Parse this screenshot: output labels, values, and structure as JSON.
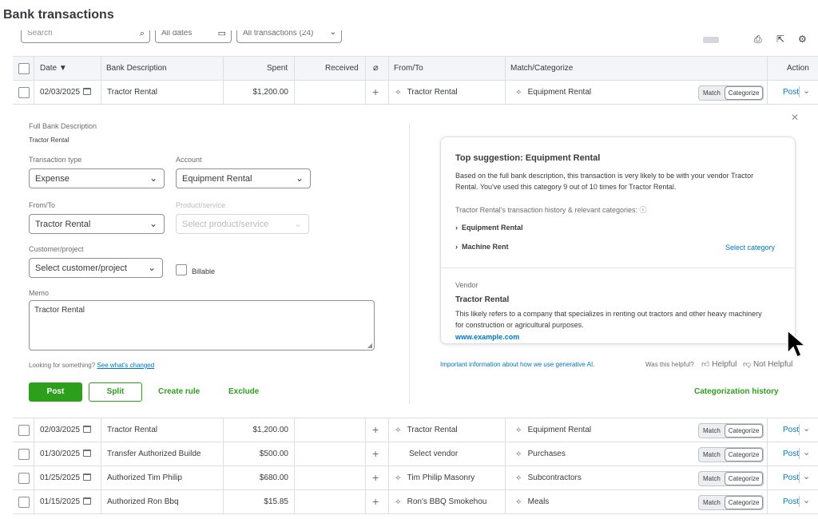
{
  "page": {
    "title": "Bank transactions"
  },
  "filters": {
    "search_placeholder": "Search",
    "dates_label": "All dates",
    "transactions_label": "All transactions (24)"
  },
  "columns": {
    "date": "Date ▼",
    "bank_description": "Bank Description",
    "spent": "Spent",
    "received": "Received",
    "from_to": "From/To",
    "match_categorize": "Match/Categorize",
    "action": "Action"
  },
  "row_buttons": {
    "match": "Match",
    "categorize": "Categorize",
    "post": "Post"
  },
  "expanded_row": {
    "date": "02/03/2025",
    "description": "Tractor Rental",
    "spent": "$1,200.00",
    "received": "",
    "from_to": "Tractor Rental",
    "category": "Equipment Rental"
  },
  "form": {
    "full_bank_description_label": "Full Bank Description",
    "full_bank_description_value": "Tractor Rental",
    "transaction_type_label": "Transaction type",
    "transaction_type_value": "Expense",
    "account_label": "Account",
    "account_value": "Equipment Rental",
    "from_to_label": "From/To",
    "from_to_value": "Tractor Rental",
    "product_service_label": "Product/service",
    "product_service_placeholder": "Select product/service",
    "customer_project_label": "Customer/project",
    "customer_project_placeholder": "Select customer/project",
    "billable_label": "Billable",
    "memo_label": "Memo",
    "memo_value": "Tractor Rental",
    "looking_text": "Looking for something?",
    "see_changed": "See what's changed",
    "post_button": "Post",
    "split_button": "Split",
    "create_rule": "Create rule",
    "exclude": "Exclude"
  },
  "suggestion": {
    "title": "Top suggestion: Equipment Rental",
    "body_line1": "Based on the full bank description, this transaction is very likely to be with your vendor Tractor",
    "body_line2": "Rental. You've used this category 9 out of 10 times for Tractor Rental.",
    "history_label": "Tractor Rental's transaction history & relevant categories:",
    "cat1": "Equipment Rental",
    "cat2": "Machine Rent",
    "select_category": "Select category",
    "vendor_label": "Vendor",
    "vendor_name": "Tractor Rental",
    "vendor_desc1": "This likely refers to a company that specializes in renting out tractors and other heavy machinery",
    "vendor_desc2": "for construction or agricultural purposes.",
    "vendor_url": "www.example.com"
  },
  "footer": {
    "ai_info": "Important information about how we use generative AI.",
    "was_helpful": "Was this helpful?",
    "helpful": "Helpful",
    "not_helpful": "Not Helpful",
    "categorization_history": "Categorization history"
  },
  "rows": [
    {
      "date": "02/03/2025",
      "description": "Tractor Rental",
      "spent": "$1,200.00",
      "from_to": "Tractor Rental",
      "vendor_tagged": true,
      "category": "Equipment Rental"
    },
    {
      "date": "01/30/2025",
      "description": "Transfer Authorized Builde",
      "spent": "$500.00",
      "from_to": "Select vendor",
      "vendor_tagged": false,
      "category": "Purchases"
    },
    {
      "date": "01/25/2025",
      "description": "Authorized Tim Philip",
      "spent": "$680.00",
      "from_to": "Tim Philip Masonry",
      "vendor_tagged": true,
      "category": "Subcontractors"
    },
    {
      "date": "01/15/2025",
      "description": "Authorized Ron Bbq",
      "spent": "$15.85",
      "from_to": "Ron's BBQ Smokehou",
      "vendor_tagged": true,
      "category": "Meals"
    }
  ],
  "colors": {
    "green": "#2ca01c",
    "blue": "#0077c5",
    "text": "#393a3d",
    "header_bg": "#f4f5f8"
  }
}
